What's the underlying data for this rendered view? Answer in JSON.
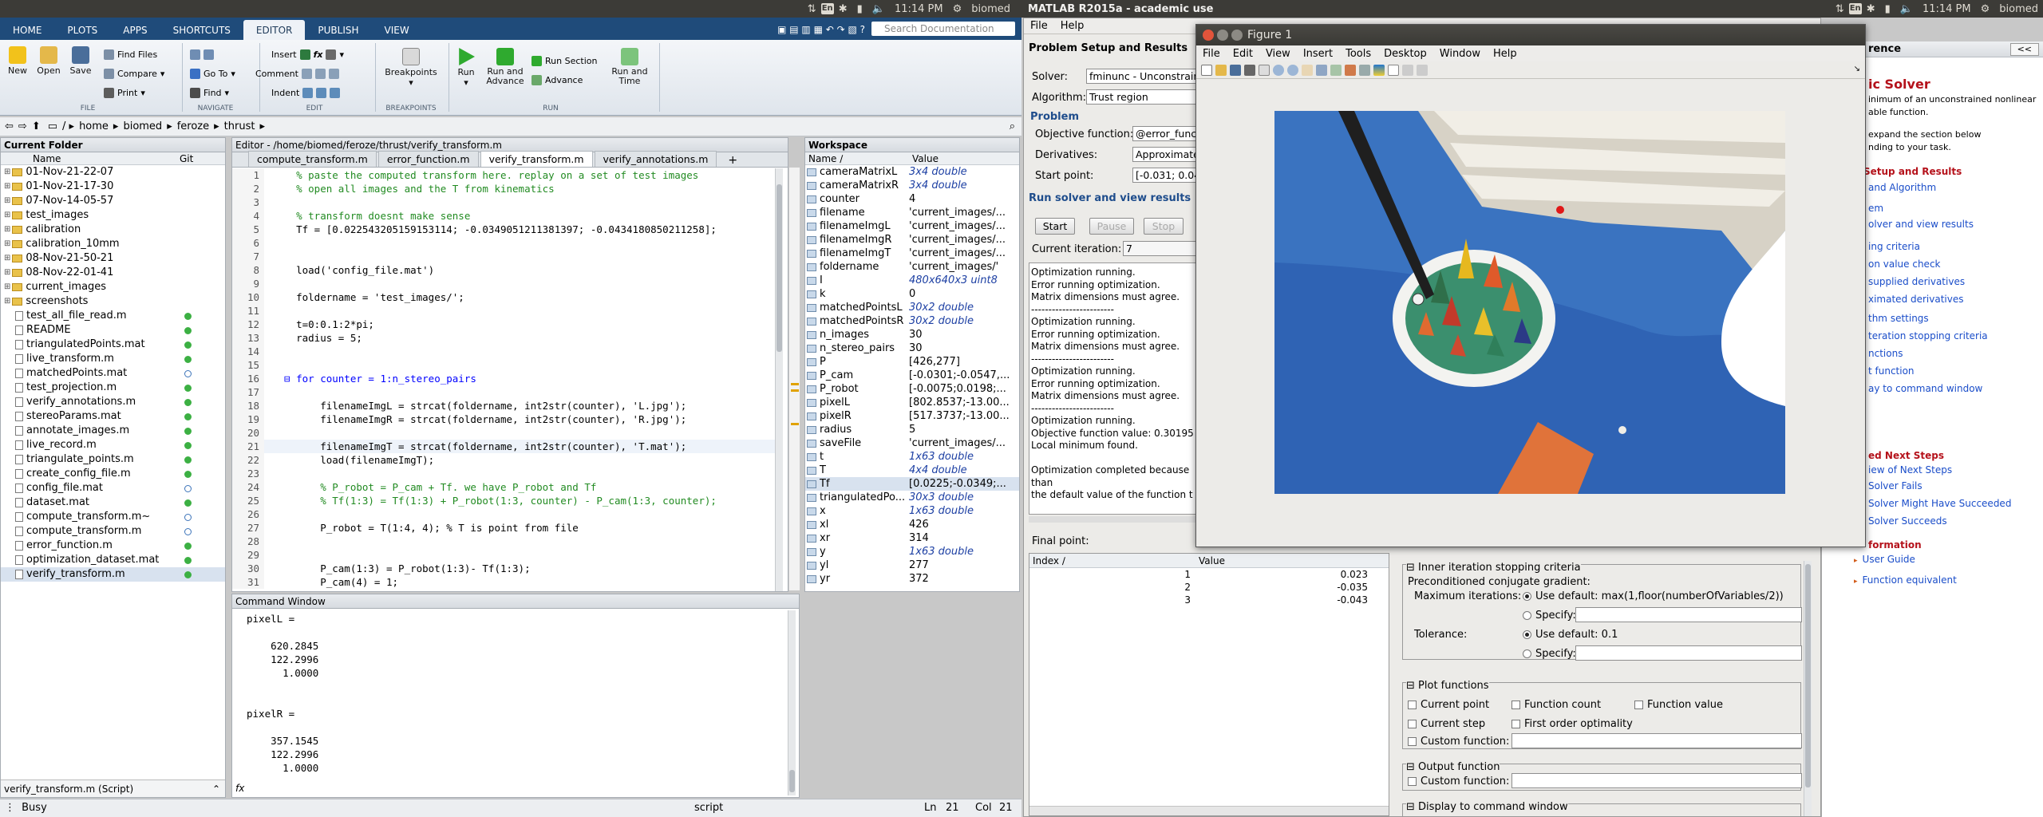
{
  "system_bar_left": {
    "time": "11:14 PM",
    "user": "biomed",
    "lang": "En"
  },
  "system_bar_right": {
    "title": "MATLAB R2015a - academic use",
    "time": "11:14 PM",
    "user": "biomed",
    "lang": "En"
  },
  "ribbon": {
    "tabs": [
      "HOME",
      "PLOTS",
      "APPS",
      "SHORTCUTS",
      "EDITOR",
      "PUBLISH",
      "VIEW"
    ],
    "active_tab": "EDITOR",
    "search_placeholder": "Search Documentation",
    "file_group": {
      "new": "New",
      "open": "Open",
      "save": "Save",
      "find_files": "Find Files",
      "compare": "Compare",
      "print": "Print",
      "label": "FILE"
    },
    "navigate_group": {
      "go_to": "Go To",
      "find": "Find",
      "label": "NAVIGATE"
    },
    "edit_group": {
      "insert": "Insert",
      "comment": "Comment",
      "indent": "Indent",
      "label": "EDIT",
      "fx": "fx"
    },
    "breakpoints_group": {
      "breakpoints": "Breakpoints",
      "label": "BREAKPOINTS"
    },
    "run_group": {
      "run": "Run",
      "run_and_advance": "Run and Advance",
      "run_section": "Run Section",
      "advance": "Advance",
      "run_and_time": "Run and Time",
      "label": "RUN"
    }
  },
  "address": {
    "path": [
      "home",
      "biomed",
      "feroze",
      "thrust"
    ]
  },
  "current_folder": {
    "title": "Current Folder",
    "col_name": "Name",
    "col_git": "Git",
    "folders": [
      "01-Nov-21-22-07",
      "01-Nov-21-17-30",
      "07-Nov-14-05-57",
      "test_images",
      "calibration",
      "calibration_10mm",
      "08-Nov-21-50-21",
      "08-Nov-22-01-41",
      "current_images",
      "screenshots"
    ],
    "files": [
      {
        "name": "test_all_file_read.m",
        "git": "green"
      },
      {
        "name": "README",
        "git": "green"
      },
      {
        "name": "triangulatedPoints.mat",
        "git": "green"
      },
      {
        "name": "live_transform.m",
        "git": "green"
      },
      {
        "name": "matchedPoints.mat",
        "git": "hollow"
      },
      {
        "name": "test_projection.m",
        "git": "green"
      },
      {
        "name": "verify_annotations.m",
        "git": "green"
      },
      {
        "name": "stereoParams.mat",
        "git": "green"
      },
      {
        "name": "annotate_images.m",
        "git": "green"
      },
      {
        "name": "live_record.m",
        "git": "green"
      },
      {
        "name": "triangulate_points.m",
        "git": "green"
      },
      {
        "name": "create_config_file.m",
        "git": "green"
      },
      {
        "name": "config_file.mat",
        "git": "hollow"
      },
      {
        "name": "dataset.mat",
        "git": "green"
      },
      {
        "name": "compute_transform.m~",
        "git": "hollow"
      },
      {
        "name": "compute_transform.m",
        "git": "hollow"
      },
      {
        "name": "error_function.m",
        "git": "green"
      },
      {
        "name": "optimization_dataset.mat",
        "git": "green"
      },
      {
        "name": "verify_transform.m",
        "git": "green"
      }
    ],
    "footer": "verify_transform.m  (Script)"
  },
  "editor": {
    "title": "Editor - /home/biomed/feroze/thrust/verify_transform.m",
    "tabs": [
      "compute_transform.m",
      "error_function.m",
      "verify_transform.m",
      "verify_annotations.m"
    ],
    "active_tab": "verify_transform.m",
    "lines": [
      {
        "n": "1",
        "t": "    % paste the computed transform here. replay on a set of test images",
        "c": "cm"
      },
      {
        "n": "2",
        "t": "    % open all images and the T from kinematics",
        "c": "cm"
      },
      {
        "n": "3",
        "t": "",
        "c": ""
      },
      {
        "n": "4",
        "t": "    % transform doesnt make sense",
        "c": "cm"
      },
      {
        "n": "5",
        "t": "    Tf = [0.022543205159153114; -0.0349051211381397; -0.0434180850211258];",
        "c": ""
      },
      {
        "n": "6",
        "t": "",
        "c": ""
      },
      {
        "n": "7",
        "t": "",
        "c": ""
      },
      {
        "n": "8",
        "t": "    load('config_file.mat')",
        "c": ""
      },
      {
        "n": "9",
        "t": "",
        "c": ""
      },
      {
        "n": "10",
        "t": "    foldername = 'test_images/';",
        "c": ""
      },
      {
        "n": "11",
        "t": "",
        "c": ""
      },
      {
        "n": "12",
        "t": "    t=0:0.1:2*pi;",
        "c": ""
      },
      {
        "n": "13",
        "t": "    radius = 5;",
        "c": ""
      },
      {
        "n": "14",
        "t": "",
        "c": ""
      },
      {
        "n": "15",
        "t": "",
        "c": ""
      },
      {
        "n": "16",
        "t": "  ⊟ for counter = 1:n_stereo_pairs",
        "c": "kw"
      },
      {
        "n": "17",
        "t": "",
        "c": ""
      },
      {
        "n": "18",
        "t": "        filenameImgL = strcat(foldername, int2str(counter), 'L.jpg');",
        "c": ""
      },
      {
        "n": "19",
        "t": "        filenameImgR = strcat(foldername, int2str(counter), 'R.jpg');",
        "c": ""
      },
      {
        "n": "20",
        "t": "",
        "c": ""
      },
      {
        "n": "21",
        "t": "        filenameImgT = strcat(foldername, int2str(counter), 'T.mat');",
        "c": ""
      },
      {
        "n": "22",
        "t": "        load(filenameImgT);",
        "c": ""
      },
      {
        "n": "23",
        "t": "",
        "c": ""
      },
      {
        "n": "24",
        "t": "        % P_robot = P_cam + Tf. we have P_robot and Tf",
        "c": "cm"
      },
      {
        "n": "25",
        "t": "        % Tf(1:3) = Tf(1:3) + P_robot(1:3, counter) - P_cam(1:3, counter);",
        "c": "cm"
      },
      {
        "n": "26",
        "t": "",
        "c": ""
      },
      {
        "n": "27",
        "t": "        P_robot = T(1:4, 4); % T is point from file",
        "c": ""
      },
      {
        "n": "28",
        "t": "",
        "c": ""
      },
      {
        "n": "29",
        "t": "",
        "c": ""
      },
      {
        "n": "30",
        "t": "        P_cam(1:3) = P_robot(1:3)- Tf(1:3);",
        "c": ""
      },
      {
        "n": "31",
        "t": "        P_cam(4) = 1;",
        "c": ""
      }
    ]
  },
  "command_window": {
    "title": "Command Window",
    "lines": [
      "pixelL =",
      "",
      "    620.2845",
      "    122.2996",
      "      1.0000",
      "",
      "",
      "pixelR =",
      "",
      "    357.1545",
      "    122.2996",
      "      1.0000"
    ],
    "prompt": "fx"
  },
  "workspace": {
    "title": "Workspace",
    "col_name": "Name ∕",
    "col_value": "Value",
    "vars": [
      {
        "name": "cameraMatrixL",
        "value": "3x4 double",
        "it": true
      },
      {
        "name": "cameraMatrixR",
        "value": "3x4 double",
        "it": true
      },
      {
        "name": "counter",
        "value": "4",
        "it": false
      },
      {
        "name": "filename",
        "value": "'current_images/...",
        "it": false
      },
      {
        "name": "filenameImgL",
        "value": "'current_images/...",
        "it": false
      },
      {
        "name": "filenameImgR",
        "value": "'current_images/...",
        "it": false
      },
      {
        "name": "filenameImgT",
        "value": "'current_images/...",
        "it": false
      },
      {
        "name": "foldername",
        "value": "'current_images/'",
        "it": false
      },
      {
        "name": "I",
        "value": "480x640x3 uint8",
        "it": true
      },
      {
        "name": "k",
        "value": "0",
        "it": false
      },
      {
        "name": "matchedPointsL",
        "value": "30x2 double",
        "it": true
      },
      {
        "name": "matchedPointsR",
        "value": "30x2 double",
        "it": true
      },
      {
        "name": "n_images",
        "value": "30",
        "it": false
      },
      {
        "name": "n_stereo_pairs",
        "value": "30",
        "it": false
      },
      {
        "name": "P",
        "value": "[426,277]",
        "it": false
      },
      {
        "name": "P_cam",
        "value": "[-0.0301;-0.0547,...",
        "it": false
      },
      {
        "name": "P_robot",
        "value": "[-0.0075;0.0198;...",
        "it": false
      },
      {
        "name": "pixelL",
        "value": "[802.8537;-13.00...",
        "it": false
      },
      {
        "name": "pixelR",
        "value": "[517.3737;-13.00...",
        "it": false
      },
      {
        "name": "radius",
        "value": "5",
        "it": false
      },
      {
        "name": "saveFile",
        "value": "'current_images/...",
        "it": false
      },
      {
        "name": "t",
        "value": "1x63 double",
        "it": true
      },
      {
        "name": "T",
        "value": "4x4 double",
        "it": true
      },
      {
        "name": "Tf",
        "value": "[0.0225;-0.0349;...",
        "it": false
      },
      {
        "name": "triangulatedPo...",
        "value": "30x3 double",
        "it": true
      },
      {
        "name": "x",
        "value": "1x63 double",
        "it": true
      },
      {
        "name": "xl",
        "value": "426",
        "it": false
      },
      {
        "name": "xr",
        "value": "314",
        "it": false
      },
      {
        "name": "y",
        "value": "1x63 double",
        "it": true
      },
      {
        "name": "yl",
        "value": "277",
        "it": false
      },
      {
        "name": "yr",
        "value": "372",
        "it": false
      }
    ]
  },
  "status_bar": {
    "state": "Busy",
    "mode": "script",
    "ln_label": "Ln",
    "ln": "21",
    "col_label": "Col",
    "col": "21"
  },
  "optim_tool": {
    "menu": [
      "File",
      "Help"
    ],
    "section_problem_setup": "Problem Setup and Results",
    "solver_label": "Solver:",
    "solver_value": "fminunc - Unconstrain",
    "algorithm_label": "Algorithm:",
    "algorithm_value": "Trust region",
    "problem_label": "Problem",
    "objective_label": "Objective function:",
    "objective_value": "@error_func",
    "derivatives_label": "Derivatives:",
    "derivatives_value": "Approximate",
    "start_label": "Start point:",
    "start_value": "[-0.031; 0.04",
    "run_section": "Run solver and view results",
    "start_btn": "Start",
    "pause_btn": "Pause",
    "stop_btn": "Stop",
    "iteration_label": "Current iteration:",
    "iteration_value": "7",
    "log": [
      "Optimization running.",
      "Error running optimization.",
      "Matrix dimensions must agree.",
      "------------------------",
      "Optimization running.",
      "Error running optimization.",
      "Matrix dimensions must agree.",
      "------------------------",
      "Optimization running.",
      "Error running optimization.",
      "Matrix dimensions must agree.",
      "------------------------",
      "Optimization running.",
      "Objective function value: 0.30195",
      "Local minimum found.",
      "",
      "Optimization completed because",
      "than",
      "the default value of the function t"
    ],
    "final_point_label": "Final point:",
    "final_cols": [
      "Index ∕",
      "Value"
    ],
    "final_rows": [
      {
        "i": "1",
        "v": "0.023"
      },
      {
        "i": "2",
        "v": "-0.035"
      },
      {
        "i": "3",
        "v": "-0.043"
      }
    ],
    "inner_iter_title": "Inner iteration stopping criteria",
    "precond_label": "Preconditioned conjugate gradient:",
    "max_iter_label": "Maximum iterations:",
    "use_default_max": "Use default: max(1,floor(numberOfVariables/2))",
    "specify": "Specify:",
    "tolerance_label": "Tolerance:",
    "use_default_tol": "Use default: 0.1",
    "plot_title": "Plot functions",
    "plot_opts": [
      "Current point",
      "Function count",
      "Function value",
      "Current step",
      "First order optimality"
    ],
    "custom_function": "Custom function:",
    "output_title": "Output function",
    "display_title": "Display to command window"
  },
  "figure": {
    "title": "Figure 1",
    "menu": [
      "File",
      "Edit",
      "View",
      "Insert",
      "Tools",
      "Desktop",
      "Window",
      "Help"
    ]
  },
  "help_panel": {
    "collapse_btn": "<<",
    "title_fragment": "rence",
    "heading": "ic Solver",
    "para1": [
      "inimum of an unconstrained nonlinear",
      "able function."
    ],
    "para2": [
      "expand the section below",
      "nding to your task."
    ],
    "links": [
      {
        "t": " Setup and Results",
        "kind": "head"
      },
      {
        "t": "and Algorithm",
        "kind": "link"
      },
      {
        "t": "em",
        "kind": "link"
      },
      {
        "t": "olver and view results",
        "kind": "link"
      },
      {
        "t": "ing criteria",
        "kind": "link"
      },
      {
        "t": "on value check",
        "kind": "link"
      },
      {
        "t": "supplied derivatives",
        "kind": "link"
      },
      {
        "t": "ximated derivatives",
        "kind": "link"
      },
      {
        "t": "thm settings",
        "kind": "link"
      },
      {
        "t": "teration stopping criteria",
        "kind": "link"
      },
      {
        "t": "nctions",
        "kind": "link"
      },
      {
        "t": "t function",
        "kind": "link"
      },
      {
        "t": "ay to command window",
        "kind": "link"
      }
    ],
    "next_steps": "ed Next Steps",
    "next_links": [
      "iew of Next Steps",
      "Solver Fails",
      "Solver Might Have Succeeded",
      "Solver Succeeds"
    ],
    "information": "formation",
    "info_links": [
      "User Guide",
      "Function equivalent"
    ]
  }
}
